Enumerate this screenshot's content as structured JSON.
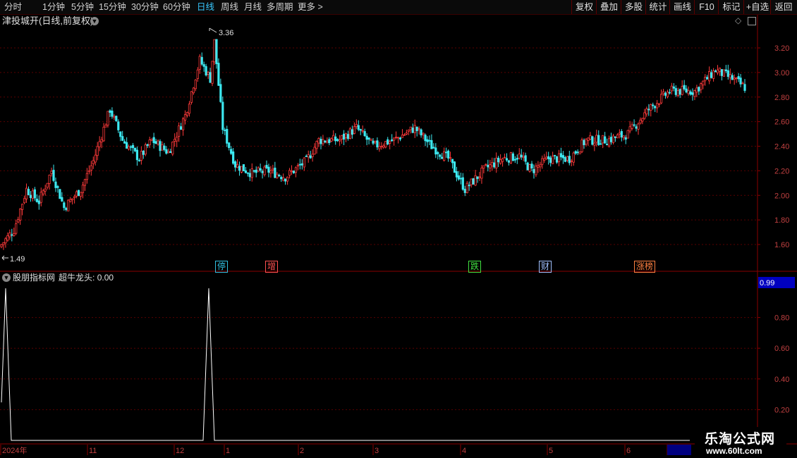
{
  "toolbar": {
    "periods": [
      "分时",
      "1分钟",
      "5分钟",
      "15分钟",
      "30分钟",
      "60分钟",
      "日线",
      "周线",
      "月线",
      "多周期"
    ],
    "active_period": "日线",
    "more": "更多",
    "buttons": [
      "复权",
      "叠加",
      "多股",
      "统计",
      "画线",
      "F10",
      "标记",
      "+自选",
      "返回"
    ]
  },
  "chart": {
    "title": "津投城开(日线,前复权)",
    "high_label": "3.36",
    "low_label": "1.49",
    "y_ticks": [
      "3.20",
      "3.00",
      "2.80",
      "2.60",
      "2.40",
      "2.20",
      "2.00",
      "1.80",
      "1.60"
    ],
    "tags": [
      {
        "text": "停",
        "color": "#30c0e0"
      },
      {
        "text": "增",
        "color": "#ff5050"
      },
      {
        "text": "跌",
        "color": "#40e040"
      },
      {
        "text": "财",
        "color": "#a0c0ff"
      },
      {
        "text": "涨榜",
        "color": "#ff8040"
      }
    ],
    "colors": {
      "up": "#ff3a3a",
      "down": "#3ce8f0",
      "grid": "#5a0000"
    }
  },
  "indicator": {
    "source": "股朋指标网",
    "name": "超牛龙头",
    "value": "0.00",
    "current_value": "0.99",
    "y_ticks": [
      "0.80",
      "0.60",
      "0.40",
      "0.20"
    ]
  },
  "x_axis": {
    "labels": [
      "2024年",
      "11",
      "12",
      "1",
      "2",
      "3",
      "4",
      "5",
      "6",
      "2025/"
    ]
  },
  "watermark": {
    "title": "乐淘公式网",
    "url": "www.60lt.com"
  }
}
